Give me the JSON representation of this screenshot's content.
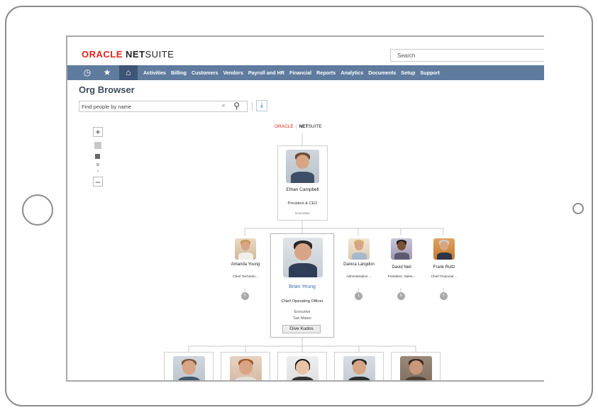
{
  "header": {
    "logo_oracle": "ORACLE",
    "logo_net": "NET",
    "logo_suite": "SUITE",
    "search_placeholder": "Search"
  },
  "nav": {
    "icons": [
      "recent-icon",
      "star-icon",
      "home-icon"
    ],
    "items": [
      "Activities",
      "Billing",
      "Customers",
      "Vendors",
      "Payroll and HR",
      "Financial",
      "Reports",
      "Analytics",
      "Documents",
      "Setup",
      "Support"
    ]
  },
  "page": {
    "title": "Org Browser",
    "find_placeholder": "Find people by name"
  },
  "chart_logo": {
    "oracle": "ORACLE",
    "net": "NET",
    "suite": "SUITE"
  },
  "ceo": {
    "name": "Ethan Campbell",
    "title": "President & CEO",
    "dept": "Executive"
  },
  "reports": [
    {
      "name": "Amanda Young",
      "title": "Chief Technolo...",
      "count": "5"
    },
    {
      "name": "Danica Langdon",
      "title": "Administrative ...",
      "count": "1"
    },
    {
      "name": "David Neil",
      "title": "President, Sales...",
      "count": "6"
    },
    {
      "name": "Frank Rultz",
      "title": "Chief Financial ...",
      "count": "5"
    }
  ],
  "selected": {
    "name": "Brian Yeung",
    "title": "Chief Operating Officer",
    "dept": "Executive",
    "location": "San Mateo",
    "kudos_label": "Give Kudos"
  },
  "colors": {
    "nav_bg": "#5f7b9e",
    "brand_red": "#e2231a",
    "link_blue": "#3b6fb0"
  }
}
